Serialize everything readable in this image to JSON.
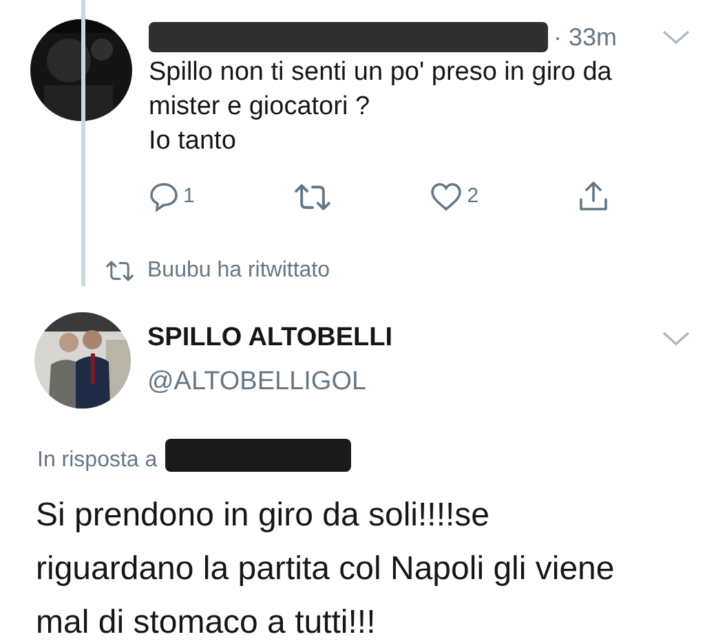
{
  "reply_tweet": {
    "time": "· 33m",
    "lines": [
      "Spillo non ti senti un po' preso in giro da",
      "mister e giocatori ?",
      "Io tanto"
    ],
    "actions": [
      {
        "kind": "reply",
        "count": "1"
      },
      {
        "kind": "retweet"
      },
      {
        "kind": "like",
        "count": "2"
      },
      {
        "kind": "share"
      }
    ]
  },
  "retweet_notice": "Buubu ha ritwittato",
  "main_tweet": {
    "name": "SPILLO ALTOBELLI",
    "handle": "@ALTOBELLIGOL",
    "in_reply_to": "In risposta a",
    "lines": [
      "Si prendono in giro da soli!!!!se",
      "riguardano la partita col Napoli gli viene",
      "mal di stomaco a tutti!!!"
    ]
  }
}
